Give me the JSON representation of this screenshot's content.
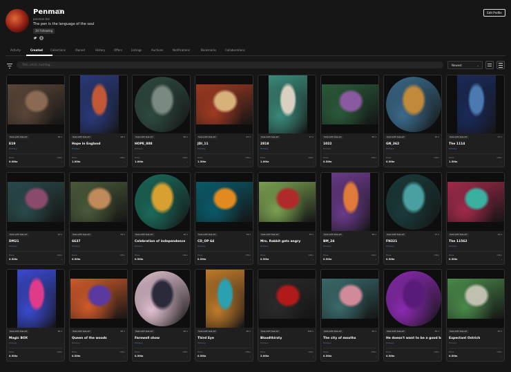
{
  "profile": {
    "name": "Penman",
    "handle": "penman.tez",
    "bio": "The pen is the language of the soul",
    "following": "34 Following",
    "edit_label": "Edit Profile"
  },
  "social_icons": [
    "twitter-icon",
    "globe-icon"
  ],
  "tabs": [
    {
      "label": "Activity"
    },
    {
      "label": "Created",
      "active": true
    },
    {
      "label": "Collections"
    },
    {
      "label": "Owned"
    },
    {
      "label": "History"
    },
    {
      "label": "Offers"
    },
    {
      "label": "Listings"
    },
    {
      "label": "Auctions"
    },
    {
      "label": "Notifications"
    },
    {
      "label": "Bookmarks"
    },
    {
      "label": "Collaborations"
    }
  ],
  "toolbar": {
    "search_placeholder": "Title, artist, hashtag...",
    "sort_value": "Newest"
  },
  "cards": [
    {
      "title": "E19",
      "edition": "18 x",
      "pill": "Sale with teia.art",
      "provenance": "Primary",
      "price_label": "Price",
      "offer_label": "Offer",
      "price": "0.08tz",
      "offer": "-",
      "colors": [
        "#5a4638",
        "#8a6a52"
      ]
    },
    {
      "title": "Hope in England",
      "edition": "18 x",
      "pill": "Sale with teia.art",
      "provenance": "Primary",
      "price_label": "Price",
      "offer_label": "Offer",
      "price": "1.00tz",
      "offer": "-",
      "colors": [
        "#2a3a7a",
        "#c05838"
      ]
    },
    {
      "title": "HOPE_888",
      "edition": "50 x",
      "pill": "Sale with teia.art",
      "provenance": "Primary",
      "price_label": "Price",
      "offer_label": "Offer",
      "price": "1.00tz",
      "offer": "-",
      "colors": [
        "#2e4a40",
        "#7a8a80"
      ]
    },
    {
      "title": "JDI_11",
      "edition": "21 x",
      "pill": "Sale with teia.art",
      "provenance": "Primary",
      "price_label": "Price",
      "offer_label": "Offer",
      "price": "1.50tz",
      "offer": "-",
      "colors": [
        "#a03a22",
        "#d8b07a"
      ]
    },
    {
      "title": "2818",
      "edition": "17 x",
      "pill": "Sale with teia.art",
      "provenance": "Primary",
      "price_label": "Price",
      "offer_label": "Offer",
      "price": "1.00tz",
      "offer": "-",
      "colors": [
        "#3a8a7a",
        "#d8d0c0"
      ]
    },
    {
      "title": "1022",
      "edition": "25 x",
      "pill": "Sale with teia.art",
      "provenance": "Primary",
      "price_label": "Price",
      "offer_label": "Offer",
      "price": "0.50tz",
      "offer": "-",
      "colors": [
        "#2a5a3a",
        "#8a5aa0"
      ]
    },
    {
      "title": "GN_362",
      "edition": "14 x",
      "pill": "Sale with teia.art",
      "provenance": "Primary",
      "price_label": "Price",
      "offer_label": "Offer",
      "price": "0.50tz",
      "offer": "-",
      "colors": [
        "#3a6a8a",
        "#c08a3a"
      ]
    },
    {
      "title": "The 1114",
      "edition": "17 x",
      "pill": "Sale with teia.art",
      "provenance": "Primary",
      "price_label": "Price",
      "offer_label": "Offer",
      "price": "1.50tz",
      "offer": "-",
      "colors": [
        "#1a2a5a",
        "#4a7ab0"
      ]
    },
    {
      "title": "DM21",
      "edition": "14 x",
      "pill": "Sale with teia.art",
      "provenance": "Primary",
      "price_label": "Price",
      "offer_label": "Offer",
      "price": "0.50tz",
      "offer": "-",
      "colors": [
        "#2a4a4a",
        "#8a4a6a"
      ]
    },
    {
      "title": "6637",
      "edition": "14 x",
      "pill": "Sale with teia.art",
      "provenance": "Primary",
      "price_label": "Price",
      "offer_label": "Offer",
      "price": "0.50tz",
      "offer": "-",
      "colors": [
        "#4a5a3a",
        "#c08a5a"
      ]
    },
    {
      "title": "Celebration of independence",
      "edition": "10 x",
      "pill": "Sale with teia.art",
      "provenance": "Primary",
      "price_label": "Price",
      "offer_label": "Offer",
      "price": "0.50tz",
      "offer": "-",
      "colors": [
        "#1a6a5a",
        "#d8a030"
      ]
    },
    {
      "title": "CD_OP 64",
      "edition": "14 x",
      "pill": "Sale with teia.art",
      "provenance": "Primary",
      "price_label": "Price",
      "offer_label": "Offer",
      "price": "0.50tz",
      "offer": "-",
      "colors": [
        "#0a5a6a",
        "#e08a20"
      ]
    },
    {
      "title": "Mrs. Rabbit gets angry",
      "edition": "15 x",
      "pill": "Sale with teia.art",
      "provenance": "Primary",
      "price_label": "Price",
      "offer_label": "Offer",
      "price": "0.50tz",
      "offer": "-",
      "colors": [
        "#7aa050",
        "#b02a2a"
      ]
    },
    {
      "title": "BM_24",
      "edition": "16 x",
      "pill": "Sale with teia.art",
      "provenance": "Primary",
      "price_label": "Price",
      "offer_label": "Offer",
      "price": "0.50tz",
      "offer": "-",
      "colors": [
        "#6a3a8a",
        "#e07a3a"
      ]
    },
    {
      "title": "FN321",
      "edition": "11 x",
      "pill": "Sale with teia.art",
      "provenance": "Primary",
      "price_label": "Price",
      "offer_label": "Offer",
      "price": "0.50tz",
      "offer": "-",
      "colors": [
        "#1a3a3a",
        "#4aa0a0"
      ]
    },
    {
      "title": "The 11562",
      "edition": "14 x",
      "pill": "Sale with teia.art",
      "provenance": "Primary",
      "price_label": "Price",
      "offer_label": "Offer",
      "price": "0.50tz",
      "offer": "-",
      "colors": [
        "#a02a4a",
        "#3ab0a0"
      ]
    },
    {
      "title": "Magic BOX",
      "edition": "36 x",
      "pill": "Sale with teia.art",
      "provenance": "Primary",
      "price_label": "Price",
      "offer_label": "Offer",
      "price": "0.50tz",
      "offer": "-",
      "colors": [
        "#3a4ad0",
        "#e03a8a"
      ]
    },
    {
      "title": "Queen of the woods",
      "edition": "20 x",
      "pill": "Sale with teia.art",
      "provenance": "Primary",
      "price_label": "Price",
      "offer_label": "Offer",
      "price": "0.50tz",
      "offer": "-",
      "colors": [
        "#d05a2a",
        "#5a3aa0"
      ]
    },
    {
      "title": "Farewell show",
      "edition": "20 x",
      "pill": "Sale with teia.art",
      "provenance": "Primary",
      "price_label": "Price",
      "offer_label": "Offer",
      "price": "0.50tz",
      "offer": "-",
      "colors": [
        "#e0c0d0",
        "#2a2a3a"
      ]
    },
    {
      "title": "Third Eye",
      "edition": "20 x",
      "pill": "Sale with teia.art",
      "provenance": "Primary",
      "price_label": "Price",
      "offer_label": "Offer",
      "price": "0.50tz",
      "offer": "-",
      "colors": [
        "#c07a2a",
        "#2aa0b0"
      ]
    },
    {
      "title": "Bloodthirsty",
      "edition": "100 x",
      "pill": "Sale with teia.art",
      "provenance": "Primary",
      "price_label": "Price",
      "offer_label": "Offer",
      "price": "2.00tz",
      "offer": "-",
      "colors": [
        "#2a2a2a",
        "#b01a1a"
      ]
    },
    {
      "title": "The city of mouths",
      "edition": "25 x",
      "pill": "Sale with teia.art",
      "provenance": "Primary",
      "price_label": "Price",
      "offer_label": "Offer",
      "price": "0.50tz",
      "offer": "-",
      "colors": [
        "#3a6a6a",
        "#d08a9a"
      ]
    },
    {
      "title": "He doesn't want to be a good boy",
      "edition": "25 x",
      "pill": "Sale with teia.art",
      "provenance": "Primary",
      "price_label": "Price",
      "offer_label": "Offer",
      "price": "0.50tz",
      "offer": "-",
      "colors": [
        "#8a2ab0",
        "#5a1a7a"
      ]
    },
    {
      "title": "Expectant Ostrich",
      "edition": "15 x",
      "pill": "Sale with teia.art",
      "provenance": "Primary",
      "price_label": "Price",
      "offer_label": "Offer",
      "price": "0.50tz",
      "offer": "-",
      "colors": [
        "#4a8a4a",
        "#c0c0b0"
      ]
    }
  ]
}
